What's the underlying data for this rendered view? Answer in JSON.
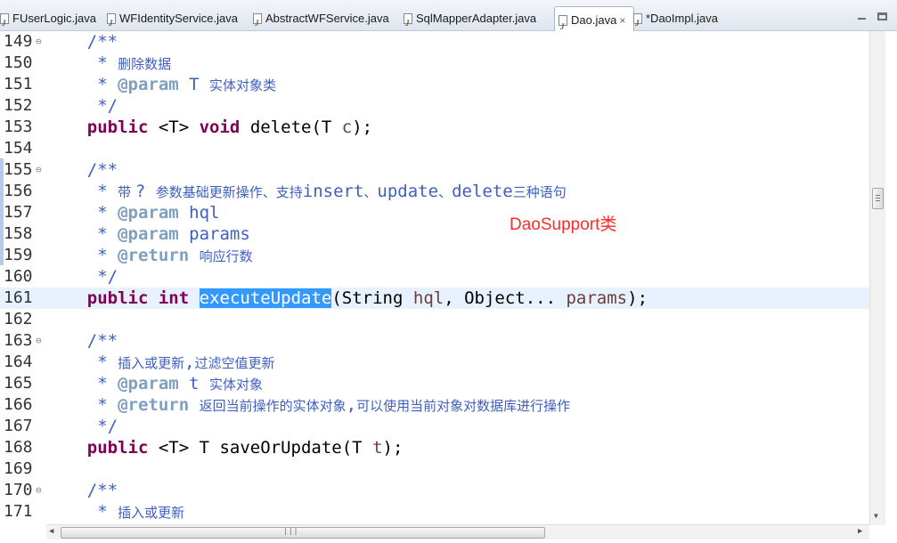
{
  "tabs": [
    {
      "label": "FUserLogic.java",
      "active": false
    },
    {
      "label": "WFIdentityService.java",
      "active": false
    },
    {
      "label": "AbstractWFService.java",
      "active": false
    },
    {
      "label": "SqlMapperAdapter.java",
      "active": false
    },
    {
      "label": "Dao.java",
      "active": true
    },
    {
      "label": "*DaoImpl.java",
      "active": false
    }
  ],
  "tab_close_glyph": "×",
  "annotation": "DaoSupport类",
  "lines": [
    {
      "n": "149",
      "fold": true,
      "tokens": [
        [
          "cm",
          "    /**"
        ]
      ]
    },
    {
      "n": "150",
      "tokens": [
        [
          "cm",
          "     * "
        ],
        [
          "cmcn",
          "删除数据"
        ]
      ]
    },
    {
      "n": "151",
      "tokens": [
        [
          "cm",
          "     * "
        ],
        [
          "tag",
          "@param"
        ],
        [
          "cm",
          " T "
        ],
        [
          "cmcn",
          "实体对象类"
        ]
      ]
    },
    {
      "n": "152",
      "tokens": [
        [
          "cm",
          "     */"
        ]
      ]
    },
    {
      "n": "153",
      "tokens": [
        [
          "pl",
          "    "
        ],
        [
          "kw",
          "public"
        ],
        [
          "pl",
          " <T> "
        ],
        [
          "kw",
          "void"
        ],
        [
          "pl",
          " delete(T "
        ],
        [
          "par",
          "c"
        ],
        [
          "pl",
          ");"
        ]
      ]
    },
    {
      "n": "154",
      "tokens": []
    },
    {
      "n": "155",
      "fold": true,
      "tokens": [
        [
          "cm",
          "    /**"
        ]
      ]
    },
    {
      "n": "156",
      "tokens": [
        [
          "cm",
          "     * "
        ],
        [
          "cmcn",
          "带 "
        ],
        [
          "cm",
          "? "
        ],
        [
          "cmcn",
          "参数基础更新操作、支持"
        ],
        [
          "cm",
          "insert"
        ],
        [
          "cmcn",
          "、"
        ],
        [
          "cm",
          "update"
        ],
        [
          "cmcn",
          "、"
        ],
        [
          "cm",
          "delete"
        ],
        [
          "cmcn",
          "三种语句"
        ]
      ]
    },
    {
      "n": "157",
      "tokens": [
        [
          "cm",
          "     * "
        ],
        [
          "tag",
          "@param"
        ],
        [
          "cm",
          " hql"
        ]
      ]
    },
    {
      "n": "158",
      "tokens": [
        [
          "cm",
          "     * "
        ],
        [
          "tag",
          "@param"
        ],
        [
          "cm",
          " params"
        ]
      ]
    },
    {
      "n": "159",
      "tokens": [
        [
          "cm",
          "     * "
        ],
        [
          "tag",
          "@return"
        ],
        [
          "cm",
          " "
        ],
        [
          "cmcn",
          "响应行数"
        ]
      ]
    },
    {
      "n": "160",
      "tokens": [
        [
          "cm",
          "     */"
        ]
      ]
    },
    {
      "n": "161",
      "current": true,
      "tokens": [
        [
          "pl",
          "    "
        ],
        [
          "kw",
          "public"
        ],
        [
          "pl",
          " "
        ],
        [
          "kw",
          "int"
        ],
        [
          "pl",
          " "
        ],
        [
          "sel",
          "executeUpdate"
        ],
        [
          "pl",
          "(String "
        ],
        [
          "par",
          "hql"
        ],
        [
          "pl",
          ", Object... "
        ],
        [
          "par",
          "params"
        ],
        [
          "pl",
          ");"
        ]
      ]
    },
    {
      "n": "162",
      "tokens": []
    },
    {
      "n": "163",
      "fold": true,
      "tokens": [
        [
          "cm",
          "    /**"
        ]
      ]
    },
    {
      "n": "164",
      "tokens": [
        [
          "cm",
          "     * "
        ],
        [
          "cmcn",
          "插入或更新"
        ],
        [
          "cm",
          ","
        ],
        [
          "cmcn",
          "过滤空值更新"
        ]
      ]
    },
    {
      "n": "165",
      "tokens": [
        [
          "cm",
          "     * "
        ],
        [
          "tag",
          "@param"
        ],
        [
          "cm",
          " t "
        ],
        [
          "cmcn",
          "实体对象"
        ]
      ]
    },
    {
      "n": "166",
      "tokens": [
        [
          "cm",
          "     * "
        ],
        [
          "tag",
          "@return"
        ],
        [
          "cm",
          " "
        ],
        [
          "cmcn",
          "返回当前操作的实体对象"
        ],
        [
          "cm",
          ","
        ],
        [
          "cmcn",
          "可以使用当前对象对数据库进行操作"
        ]
      ]
    },
    {
      "n": "167",
      "tokens": [
        [
          "cm",
          "     */"
        ]
      ]
    },
    {
      "n": "168",
      "tokens": [
        [
          "pl",
          "    "
        ],
        [
          "kw",
          "public"
        ],
        [
          "pl",
          " <T> T saveOrUpdate(T "
        ],
        [
          "par",
          "t"
        ],
        [
          "pl",
          ");"
        ]
      ]
    },
    {
      "n": "169",
      "tokens": []
    },
    {
      "n": "170",
      "fold": true,
      "tokens": [
        [
          "cm",
          "    /**"
        ]
      ]
    },
    {
      "n": "171",
      "tokens": [
        [
          "cm",
          "     * "
        ],
        [
          "cmcn",
          "插入或更新"
        ]
      ]
    }
  ]
}
